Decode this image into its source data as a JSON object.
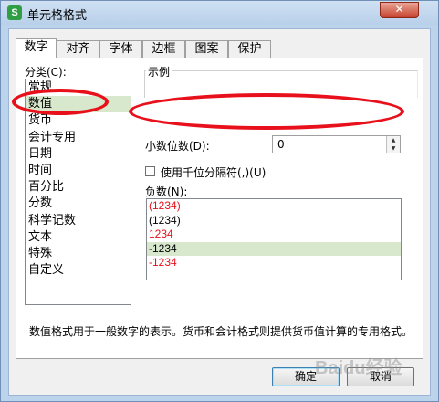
{
  "window": {
    "title": "单元格格式",
    "app_icon_letter": "S",
    "close_glyph": "✕"
  },
  "tabs": [
    {
      "label": "数字",
      "active": true
    },
    {
      "label": "对齐"
    },
    {
      "label": "字体"
    },
    {
      "label": "边框"
    },
    {
      "label": "图案"
    },
    {
      "label": "保护"
    }
  ],
  "category": {
    "label": "分类(C):",
    "items": [
      "常规",
      "数值",
      "货币",
      "会计专用",
      "日期",
      "时间",
      "百分比",
      "分数",
      "科学记数",
      "文本",
      "特殊",
      "自定义"
    ],
    "selected": "数值"
  },
  "sample": {
    "label": "示例"
  },
  "decimal": {
    "label": "小数位数(D):",
    "value": "0"
  },
  "separator": {
    "label": "使用千位分隔符(,)(U)",
    "checked": false
  },
  "negative": {
    "label": "负数(N):",
    "items": [
      {
        "text": "(1234)",
        "color": "#e8101a"
      },
      {
        "text": "(1234)",
        "color": "#000000"
      },
      {
        "text": "1234",
        "color": "#e8101a"
      },
      {
        "text": "-1234",
        "color": "#000000"
      },
      {
        "text": "-1234",
        "color": "#e8101a"
      }
    ],
    "selected_index": 3
  },
  "description": "数值格式用于一般数字的表示。货币和会计格式则提供货币值计算的专用格式。",
  "buttons": {
    "ok": "确定",
    "cancel": "取消"
  },
  "watermark": "Baidu经验",
  "colors": {
    "highlight_red": "#e8101a",
    "selection_green": "#d8e8cd",
    "frame_blue": "#bcd3ec"
  }
}
